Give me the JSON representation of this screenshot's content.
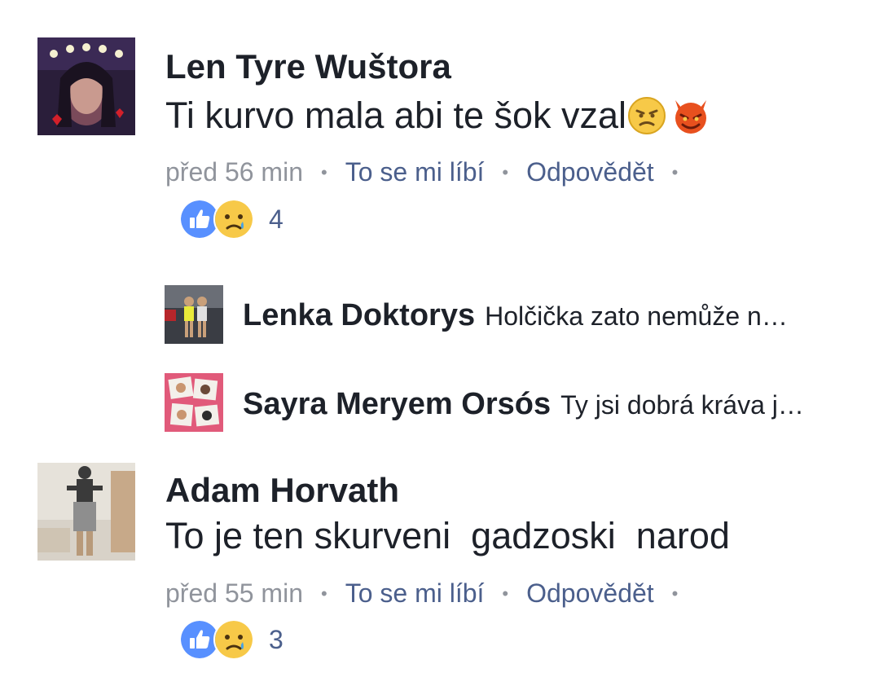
{
  "comments": [
    {
      "author": "Len Tyre Wuštora",
      "text": "Ti kurvo mala abi te šok vzal",
      "emojis": [
        "angry-face",
        "devil-face"
      ],
      "time": "před 56 min",
      "like": "To se mi líbí",
      "reply": "Odpovědět",
      "reaction_count": "4",
      "reaction_icons": [
        "like-icon",
        "sad-icon"
      ]
    },
    {
      "author": "Adam Horvath",
      "text": "To je ten skurveni  gadzoski  narod",
      "time": "před 55 min",
      "like": "To se mi líbí",
      "reply": "Odpovědět",
      "reaction_count": "3",
      "reaction_icons": [
        "like-icon",
        "sad-icon"
      ]
    }
  ],
  "replies": [
    {
      "author": "Lenka Doktorys",
      "preview": "Holčička zato nemůže n…"
    },
    {
      "author": "Sayra Meryem Orsós",
      "preview": "Ty jsi dobrá kráva j…"
    }
  ],
  "colors": {
    "text": "#1d2129",
    "meta": "#90949c",
    "link": "#4b5f8c",
    "like_blue": "#5890ff",
    "sad_yellow": "#f7c948"
  }
}
